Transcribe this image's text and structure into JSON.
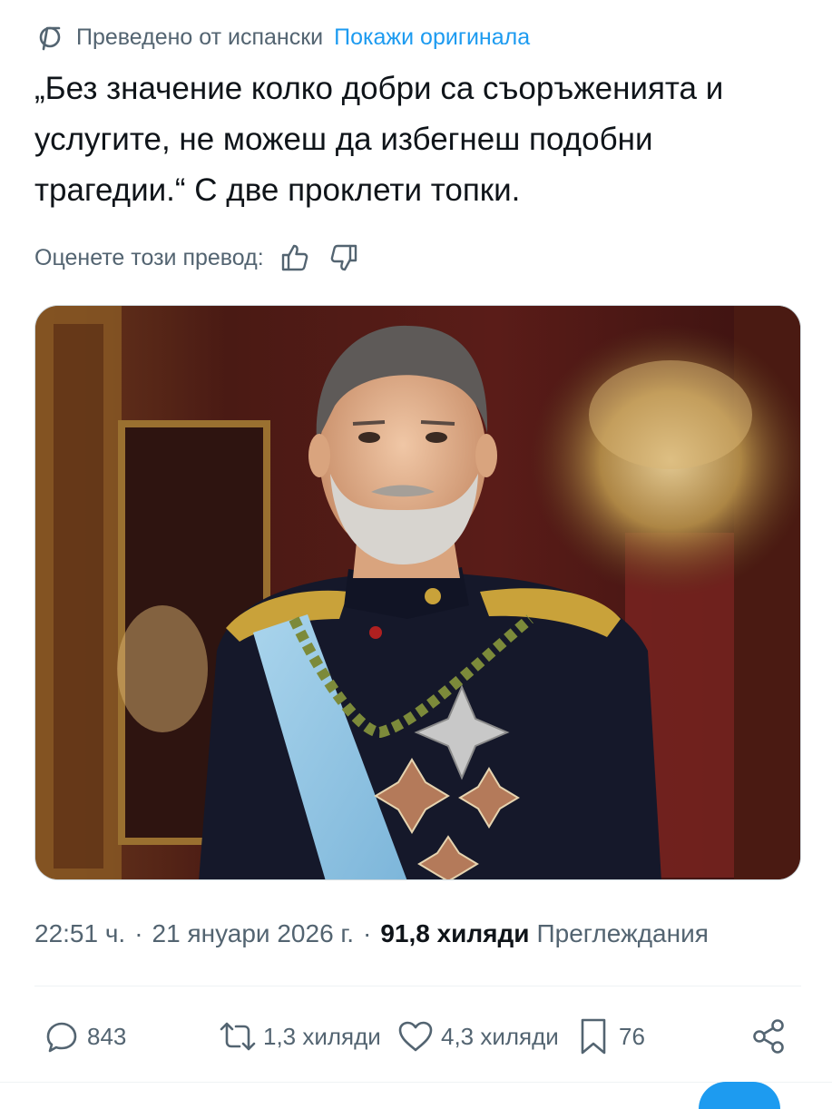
{
  "translation": {
    "translated_from": "Преведено от испански",
    "show_original": "Покажи оригинала"
  },
  "tweet": {
    "text": "„Без значение колко добри са съоръженията и услугите, не можеш да избегнеш подобни трагедии.“ С две проклети топки."
  },
  "rate": {
    "label": "Оценете този превод:",
    "thumb_up_icon": "thumbs-up-icon",
    "thumb_down_icon": "thumbs-down-icon"
  },
  "media": {
    "type": "photo"
  },
  "meta": {
    "time": "22:51 ч.",
    "separator": "·",
    "date": "21 януари 2026 г.",
    "views_count": "91,8 хиляди",
    "views_label": "Преглеждания"
  },
  "actions": {
    "replies": {
      "icon": "reply-icon",
      "count": "843"
    },
    "reposts": {
      "icon": "repost-icon",
      "count": "1,3 хиляди"
    },
    "likes": {
      "icon": "heart-icon",
      "count": "4,3 хиляди"
    },
    "bookmarks": {
      "icon": "bookmark-icon",
      "count": "76"
    },
    "share": {
      "icon": "share-icon"
    }
  },
  "colors": {
    "text": "#0f1419",
    "secondary": "#536471",
    "accent": "#1d9bf0"
  }
}
